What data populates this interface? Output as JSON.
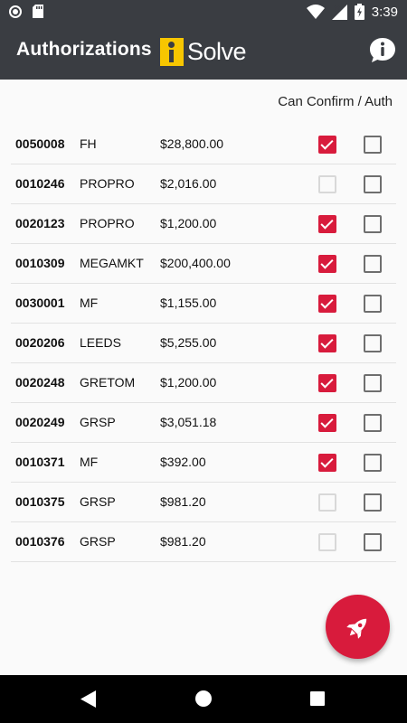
{
  "status_bar": {
    "time": "3:39"
  },
  "app_bar": {
    "title": "Authorizations",
    "logo_text": "Solve",
    "logo_letter": "i"
  },
  "list": {
    "column_header": "Can Confirm / Auth",
    "rows": [
      {
        "code": "0050008",
        "client": "FH",
        "amount": "$28,800.00",
        "confirm": "checked",
        "auth": "unchecked"
      },
      {
        "code": "0010246",
        "client": "PROPRO",
        "amount": "$2,016.00",
        "confirm": "disabled",
        "auth": "unchecked"
      },
      {
        "code": "0020123",
        "client": "PROPRO",
        "amount": "$1,200.00",
        "confirm": "checked",
        "auth": "unchecked"
      },
      {
        "code": "0010309",
        "client": "MEGAMKT",
        "amount": "$200,400.00",
        "confirm": "checked",
        "auth": "unchecked"
      },
      {
        "code": "0030001",
        "client": "MF",
        "amount": "$1,155.00",
        "confirm": "checked",
        "auth": "unchecked"
      },
      {
        "code": "0020206",
        "client": "LEEDS",
        "amount": "$5,255.00",
        "confirm": "checked",
        "auth": "unchecked"
      },
      {
        "code": "0020248",
        "client": "GRETOM",
        "amount": "$1,200.00",
        "confirm": "checked",
        "auth": "unchecked"
      },
      {
        "code": "0020249",
        "client": "GRSP",
        "amount": "$3,051.18",
        "confirm": "checked",
        "auth": "unchecked"
      },
      {
        "code": "0010371",
        "client": "MF",
        "amount": "$392.00",
        "confirm": "checked",
        "auth": "unchecked"
      },
      {
        "code": "0010375",
        "client": "GRSP",
        "amount": "$981.20",
        "confirm": "disabled",
        "auth": "unchecked"
      },
      {
        "code": "0010376",
        "client": "GRSP",
        "amount": "$981.20",
        "confirm": "disabled",
        "auth": "unchecked"
      }
    ]
  },
  "fab": {
    "icon": "rocket-icon"
  },
  "colors": {
    "app_bar": "#3a3d42",
    "accent": "#d81b3c",
    "logo_yellow": "#f7c600"
  },
  "nav_bar": {
    "back_icon": "back-icon",
    "home_icon": "home-icon",
    "recent_icon": "recent-apps-icon"
  }
}
